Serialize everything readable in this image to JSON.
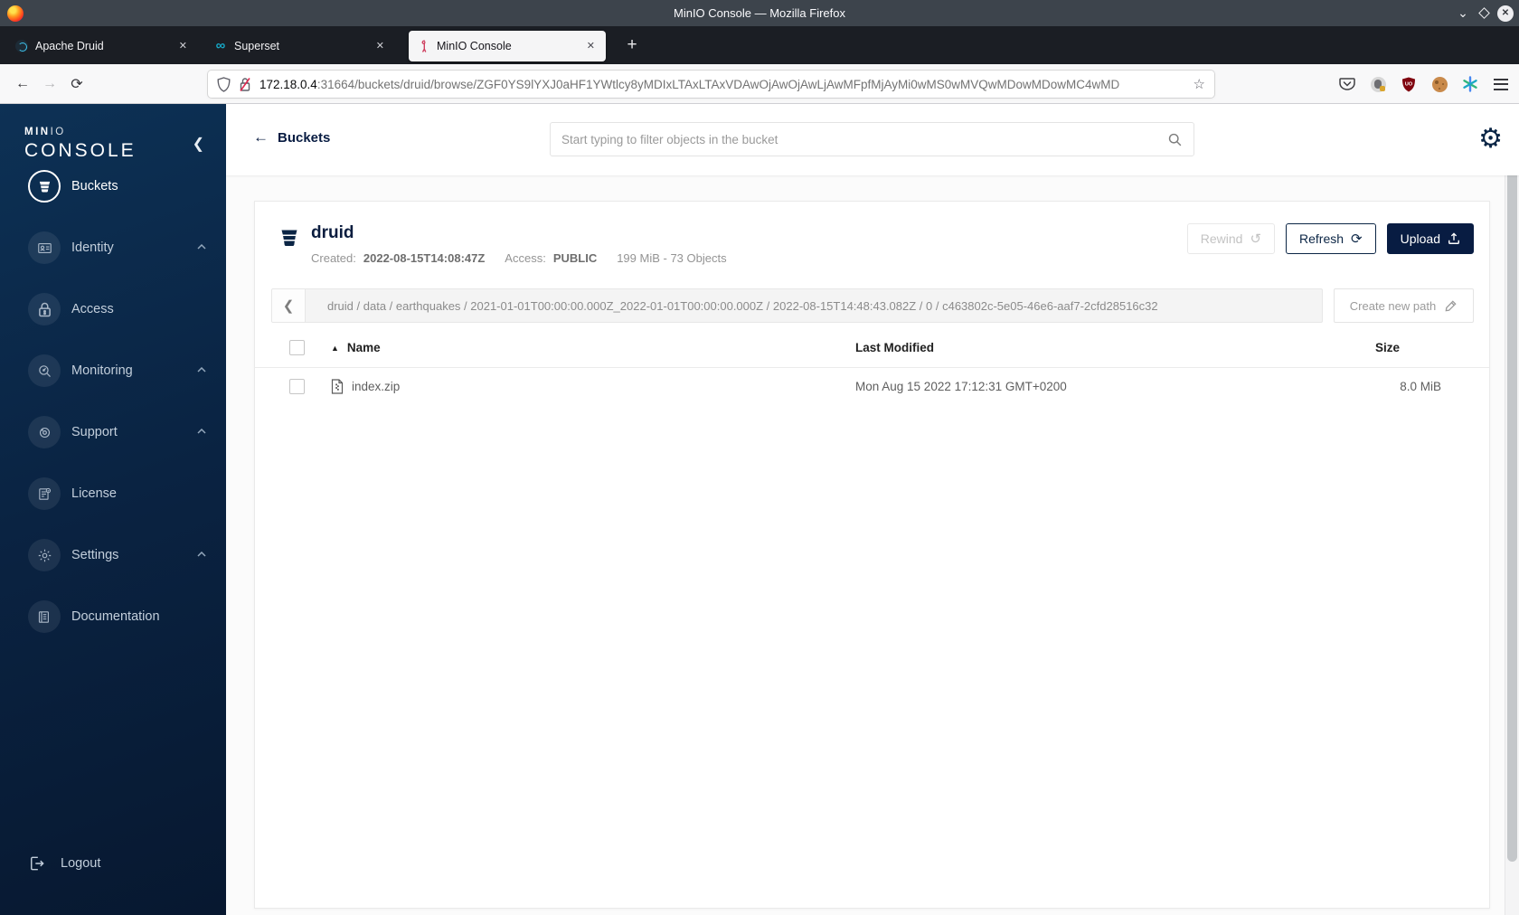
{
  "window": {
    "title": "MinIO Console — Mozilla Firefox"
  },
  "tabs": [
    {
      "title": "Apache Druid"
    },
    {
      "title": "Superset"
    },
    {
      "title": "MinIO Console"
    }
  ],
  "urlbar": {
    "host": "172.18.0.4",
    "path": ":31664/buckets/druid/browse/ZGF0YS9lYXJ0aHF1YWtlcy8yMDIxLTAxLTAxVDAwOjAwOjAwLjAwMFpfMjAyMi0wMS0wMVQwMDowMDowMC4wMD"
  },
  "sidebar": {
    "logo_min": "MIN",
    "logo_io": "IO",
    "logo_console": "CONSOLE",
    "items": [
      {
        "label": "Buckets"
      },
      {
        "label": "Identity"
      },
      {
        "label": "Access"
      },
      {
        "label": "Monitoring"
      },
      {
        "label": "Support"
      },
      {
        "label": "License"
      },
      {
        "label": "Settings"
      },
      {
        "label": "Documentation"
      }
    ],
    "logout": "Logout"
  },
  "header": {
    "back_label": "Buckets",
    "search_placeholder": "Start typing to filter objects in the bucket"
  },
  "bucket": {
    "name": "druid",
    "created_label": "Created:",
    "created": "2022-08-15T14:08:47Z",
    "access_label": "Access:",
    "access": "PUBLIC",
    "usage": "199 MiB - 73 Objects"
  },
  "actions": {
    "rewind": "Rewind",
    "refresh": "Refresh",
    "upload": "Upload",
    "create_path": "Create new path"
  },
  "breadcrumb": {
    "path": "druid / data / earthquakes / 2021-01-01T00:00:00.000Z_2022-01-01T00:00:00.000Z / 2022-08-15T14:48:43.082Z / 0 / c463802c-5e05-46e6-aaf7-2cfd28516c32"
  },
  "table": {
    "headers": {
      "name": "Name",
      "modified": "Last Modified",
      "size": "Size"
    },
    "rows": [
      {
        "name": "index.zip",
        "modified": "Mon Aug 15 2022 17:12:31 GMT+0200",
        "size": "8.0 MiB"
      }
    ]
  },
  "icons": {
    "minimize": "⌄",
    "close": "✕",
    "new_tab": "+",
    "infinity": "∞",
    "back": "←",
    "forward": "→",
    "reload": "⟳",
    "star": "☆",
    "collapse": "❮",
    "path_back": "❮",
    "sort_asc": "▲",
    "gear": "⚙",
    "rewind": "↺",
    "refresh": "⟳"
  },
  "colors": {
    "accent_navy": "#081C42",
    "sidebar_top": "#0D3155",
    "sidebar_bottom": "#071830",
    "active_tab_bg": "#F5F5F6",
    "disabled_text": "#C3C3C3",
    "ublock_red": "#800610"
  }
}
